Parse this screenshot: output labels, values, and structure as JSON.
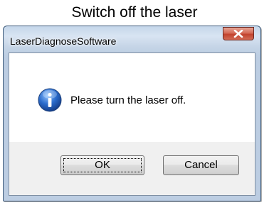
{
  "caption": "Switch off the laser",
  "dialog": {
    "title": "LaserDiagnoseSoftware",
    "close_symbol": "x",
    "icon": "info-icon",
    "message": "Please turn the laser off.",
    "buttons": {
      "ok_label": "OK",
      "cancel_label": "Cancel"
    }
  },
  "colors": {
    "close_button": "#c2432e",
    "info_icon": "#1f5fb5"
  }
}
